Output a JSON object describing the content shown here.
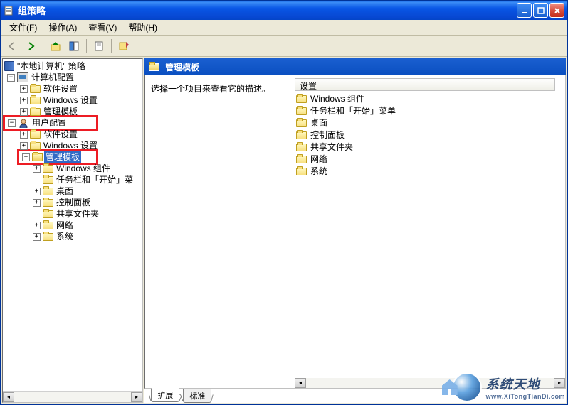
{
  "window": {
    "title": "组策略"
  },
  "menu": {
    "file": "文件(F)",
    "action": "操作(A)",
    "view": "查看(V)",
    "help": "帮助(H)"
  },
  "tree": {
    "root": "\"本地计算机\" 策略",
    "computer_config": "计算机配置",
    "software_settings": "软件设置",
    "windows_settings": "Windows 设置",
    "admin_templates": "管理模板",
    "user_config": "用户配置",
    "user_software_settings": "软件设置",
    "user_windows_settings": "Windows 设置",
    "user_admin_templates": "管理模板",
    "at_windows_components": "Windows 组件",
    "at_taskbar_start": "任务栏和「开始」菜",
    "at_desktop": "桌面",
    "at_control_panel": "控制面板",
    "at_shared_folders": "共享文件夹",
    "at_network": "网络",
    "at_system": "系统"
  },
  "detail": {
    "header_title": "管理模板",
    "prompt": "选择一个项目来查看它的描述。",
    "column_header": "设置",
    "items": [
      "Windows 组件",
      "任务栏和「开始」菜单",
      "桌面",
      "控制面板",
      "共享文件夹",
      "网络",
      "系统"
    ]
  },
  "tabs": {
    "extended": "扩展",
    "standard": "标准"
  },
  "watermark": {
    "line1": "系统天地",
    "line2": "www.XiTongTianDi.com"
  }
}
